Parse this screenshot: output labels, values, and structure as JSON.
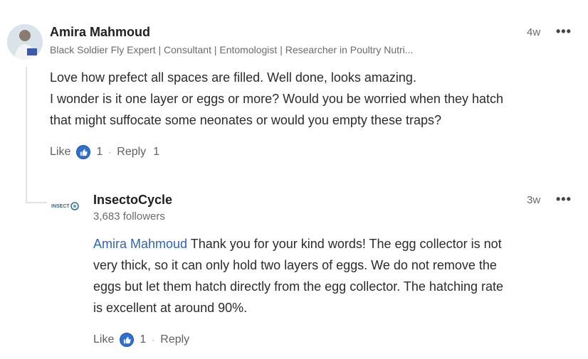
{
  "comment": {
    "author": "Amira Mahmoud",
    "headline": "Black Soldier Fly Expert | Consultant | Entomologist | Researcher in Poultry Nutri...",
    "time": "4w",
    "more": "•••",
    "lines": [
      "Love how prefect all spaces are filled. Well done, looks amazing.",
      "I wonder is it one layer or eggs or more? Would you be worried when they hatch",
      "that might suffocate some neonates or would you empty these traps?"
    ],
    "like_label": "Like",
    "reaction_count": "1",
    "separator": "·",
    "reply_label": "Reply",
    "reply_count": "1"
  },
  "reply": {
    "logo_text": "INSECT",
    "author": "InsectoCycle",
    "followers": "3,683 followers",
    "time": "3w",
    "more": "•••",
    "mention": "Amira Mahmoud",
    "line1_rest": " Thank you for your kind words! The egg collector is not",
    "lines": [
      "very thick, so it can only hold two layers of eggs. We do not remove the",
      "eggs but let them hatch directly from the egg collector. The hatching rate",
      "is excellent at around 90%."
    ],
    "like_label": "Like",
    "reaction_count": "1",
    "separator": "·",
    "reply_label": "Reply"
  },
  "colors": {
    "mention": "#2e64b8",
    "like_badge": "#2e6fd0",
    "thread_line": "#e2e2e2"
  },
  "icons": {
    "reaction": "thumbs-up-icon",
    "more": "ellipsis-icon"
  }
}
